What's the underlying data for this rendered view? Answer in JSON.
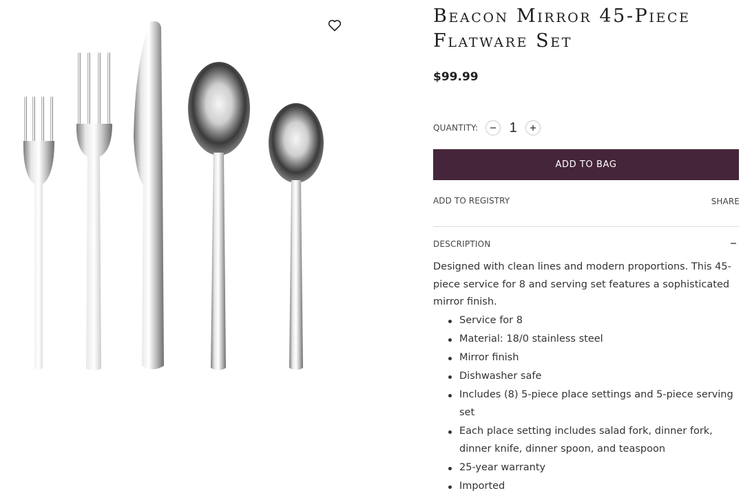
{
  "product": {
    "title": "Beacon Mirror 45-Piece Flatware Set",
    "price": "$99.99",
    "image_alt": "flatware-place-setting-image"
  },
  "wishlist": {
    "icon": "heart-icon"
  },
  "quantity": {
    "label": "QUANTITY:",
    "value": "1",
    "decrement_icon": "minus-icon",
    "increment_icon": "plus-icon"
  },
  "actions": {
    "add_to_bag": "ADD TO BAG",
    "add_to_registry": "ADD TO REGISTRY",
    "share": "SHARE"
  },
  "description": {
    "header": "DESCRIPTION",
    "toggle_icon": "collapse-minus-icon",
    "intro": "Designed with clean lines and modern proportions. This 45-piece service for 8 and serving set features a sophisticated mirror finish.",
    "bullets": [
      "Service for 8",
      "Material: 18/0 stainless steel",
      "Mirror finish",
      "Dishwasher safe",
      "Includes (8) 5-piece place settings and 5-piece serving set",
      "Each place setting includes salad fork, dinner fork, dinner knife, dinner spoon, and teaspoon",
      "25-year warranty",
      "Imported"
    ]
  },
  "colors": {
    "add_to_bag_bg": "#45253a",
    "text": "#333333",
    "divider": "#dcdcdc"
  }
}
